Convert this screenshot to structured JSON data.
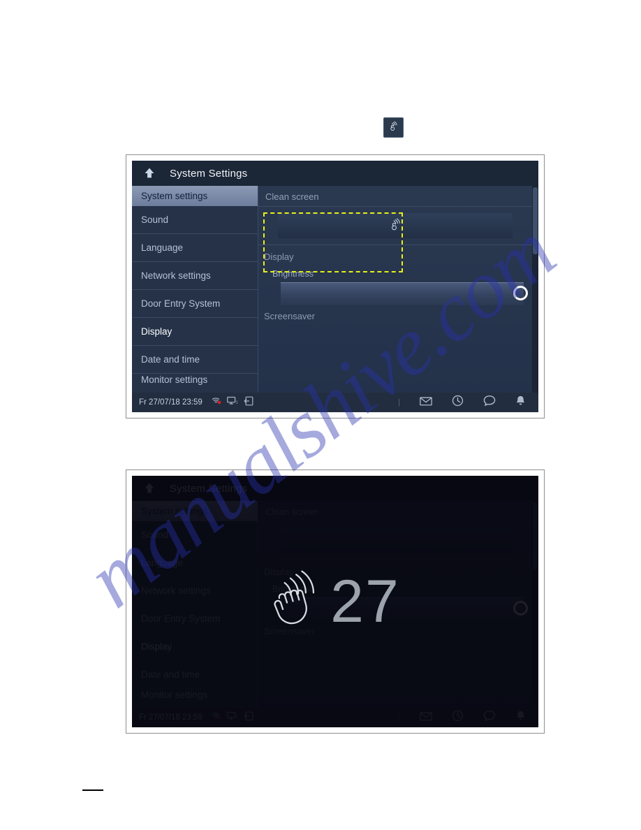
{
  "watermark": {
    "text": "manualshive.com"
  },
  "inline_badge": {
    "icon": "clean-screen-hand-icon"
  },
  "device": {
    "titlebar": {
      "back_icon": "back-up-arrow-icon",
      "title": "System Settings"
    },
    "sidebar": {
      "header": "System settings",
      "items": [
        {
          "label": "Sound",
          "selected": false
        },
        {
          "label": "Language",
          "selected": false
        },
        {
          "label": "Network settings",
          "selected": false
        },
        {
          "label": "Door Entry System",
          "selected": false
        },
        {
          "label": "Display",
          "selected": true
        },
        {
          "label": "Date and time",
          "selected": false
        },
        {
          "label": "Monitor settings",
          "selected": false
        }
      ]
    },
    "content": {
      "clean_screen_label": "Clean screen",
      "clean_screen_button_icon": "clean-screen-hand-icon",
      "display_group_label": "Display",
      "brightness_label": "Brightness",
      "brightness_value": 100,
      "screensaver_label": "Screensaver"
    },
    "statusbar": {
      "datetime": "Fr 27/07/18  23:59",
      "left_icons": [
        "wifi-disconnected-icon",
        "monitor-1-icon",
        "door-entry-icon"
      ],
      "right_icons": [
        "mail-icon",
        "history-icon",
        "message-icon",
        "bell-icon"
      ]
    }
  },
  "overlay": {
    "hand_icon": "waving-hand-icon",
    "countdown": "27"
  },
  "colors": {
    "highlight": "#e9f117",
    "panel_bg": "#243249",
    "sidebar_bg": "#253248",
    "accent_text": "#ffffff",
    "watermark": "#2832af"
  }
}
